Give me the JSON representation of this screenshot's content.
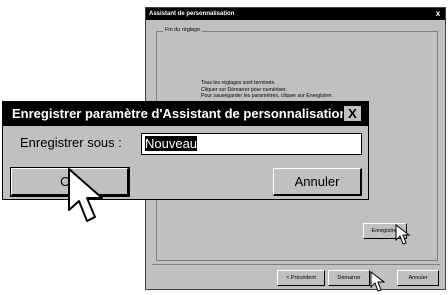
{
  "wizard": {
    "title": "Assistant de personnalisation",
    "close": "x",
    "group_label": "Fin du réglage",
    "messages": [
      "Tous les réglages sont terminés.",
      "Cliquer sur Démarrer pour numériser.",
      "Pour sauvegarder les paramètres, cliquer sur Enregistrer."
    ],
    "save_button": "Enregistrer",
    "prev_button": "< Précédent",
    "start_button": "Démarrer",
    "cancel_button": "Annuler"
  },
  "dialog": {
    "title": "Enregistrer paramètre d'Assistant de personnalisation",
    "close": "X",
    "label": "Enregistrer sous :",
    "input_value": "Nouveau",
    "ok_button": "OK",
    "cancel_button": "Annuler"
  },
  "icons": [
    "arrow-cursor-icon",
    "close-icon"
  ]
}
